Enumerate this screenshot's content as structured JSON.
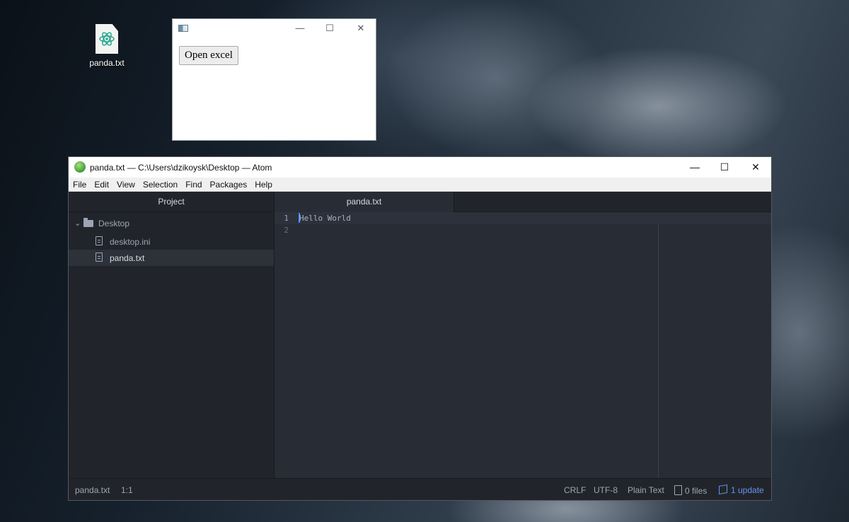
{
  "desktop": {
    "icon_label": "panda.txt"
  },
  "tk_window": {
    "button_label": "Open excel",
    "controls": {
      "minimize": "—",
      "maximize": "☐",
      "close": "✕"
    }
  },
  "atom": {
    "title": "panda.txt — C:\\Users\\dzikoysk\\Desktop — Atom",
    "controls": {
      "minimize": "—",
      "maximize": "☐",
      "close": "✕"
    },
    "menu": [
      "File",
      "Edit",
      "View",
      "Selection",
      "Find",
      "Packages",
      "Help"
    ],
    "tree": {
      "header": "Project",
      "root": "Desktop",
      "files": [
        "desktop.ini",
        "panda.txt"
      ]
    },
    "tab": "panda.txt",
    "editor": {
      "lines": [
        {
          "num": "1",
          "text": "Hello World"
        },
        {
          "num": "2",
          "text": ""
        }
      ]
    },
    "status": {
      "file": "panda.txt",
      "position": "1:1",
      "line_ending": "CRLF",
      "encoding": "UTF-8",
      "grammar": "Plain Text",
      "git_files": "0 files",
      "updates": "1 update"
    }
  },
  "colors": {
    "accent": "#6494ed",
    "cursor": "#528bff",
    "editor_bg": "#282c34",
    "panel_bg": "#21252b"
  }
}
